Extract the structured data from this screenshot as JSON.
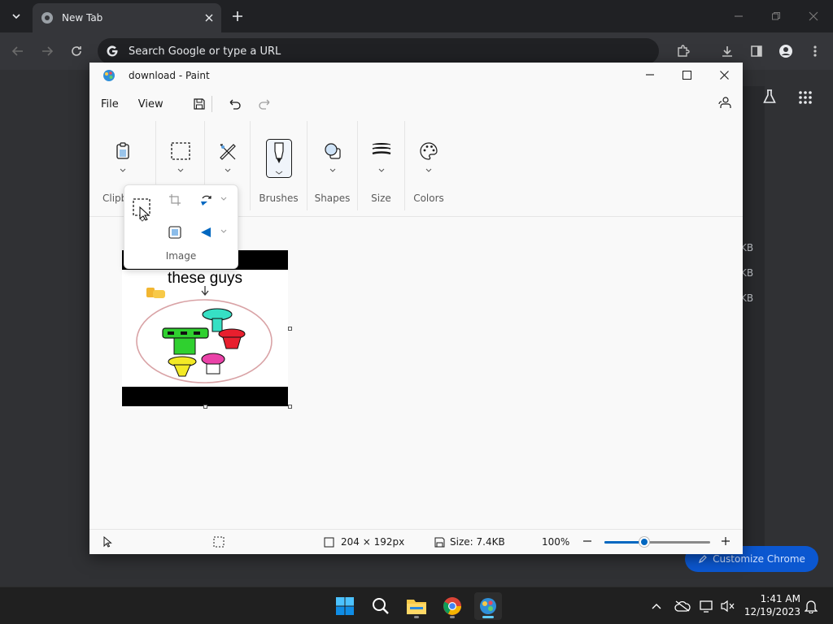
{
  "chrome": {
    "tab_title": "New Tab",
    "omnibox_placeholder": "Search Google or type a URL",
    "customize_label": "Customize Chrome",
    "behind_sizes": [
      "KB",
      "KB",
      "KB"
    ]
  },
  "paint": {
    "window_title": "download - Paint",
    "menu": {
      "file": "File",
      "view": "View"
    },
    "ribbon": {
      "clipboard_label": "Clipb",
      "image_label": "Image",
      "brushes_label": "Brushes",
      "shapes_label": "Shapes",
      "size_label": "Size",
      "colors_label": "Colors"
    },
    "image_content": {
      "caption": "these guys"
    },
    "status": {
      "dimensions": "204 × 192px",
      "file_size": "Size: 7.4KB",
      "zoom": "100%",
      "zoom_level": 0.38
    }
  },
  "taskbar": {
    "time": "1:41 AM",
    "date": "12/19/2023"
  },
  "colors": {
    "accent": "#0067c0",
    "taskbar_active": "#60cdff"
  }
}
